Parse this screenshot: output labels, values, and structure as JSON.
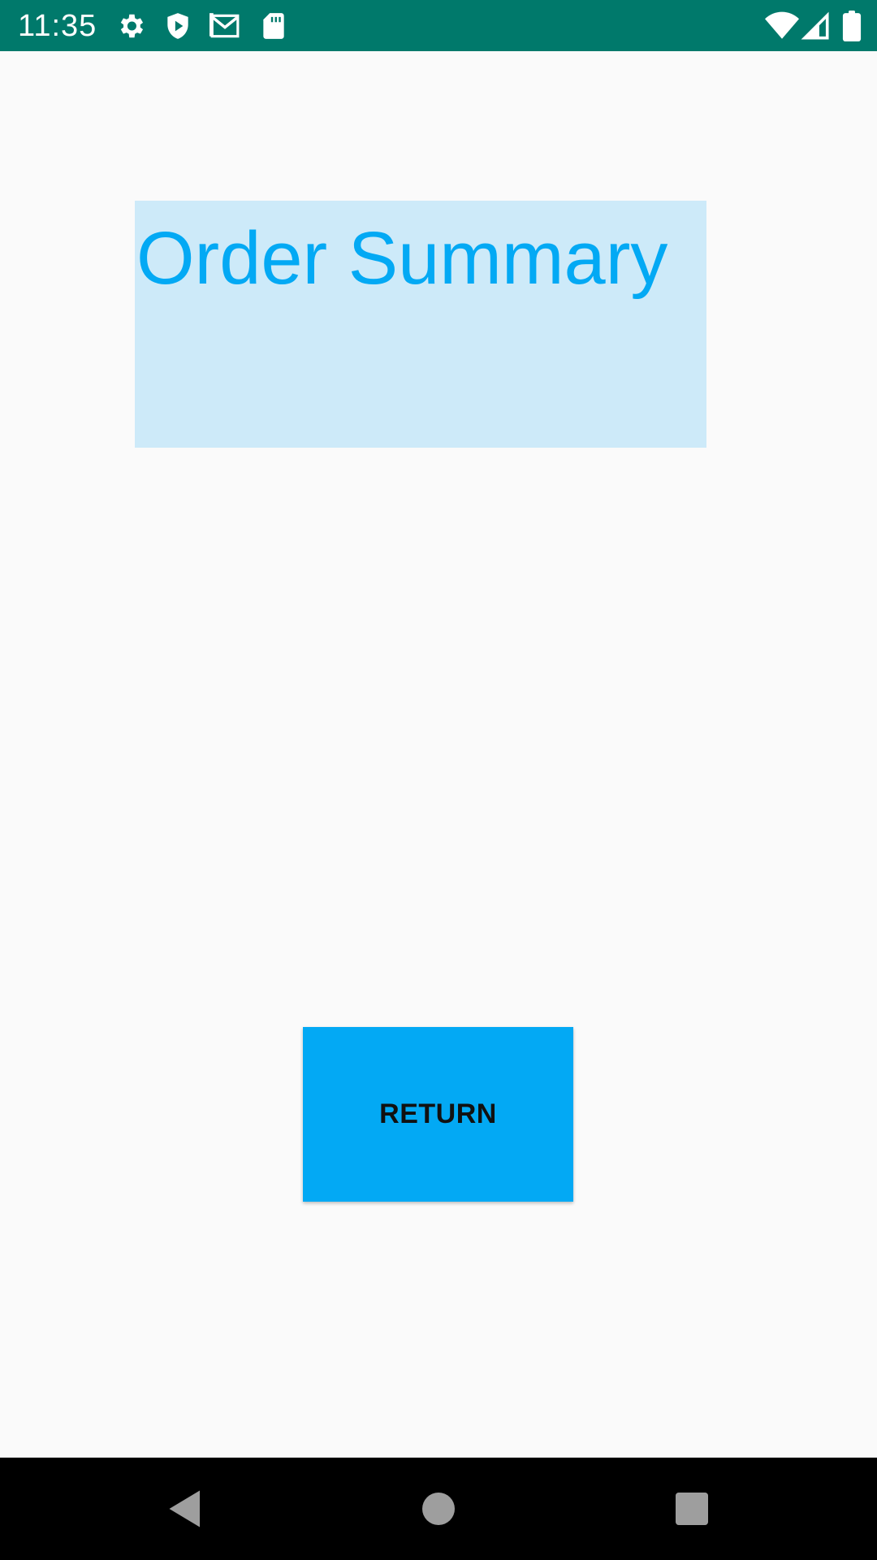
{
  "status_bar": {
    "time": "11:35",
    "background_color": "#00796b",
    "left_icons": [
      "gear-icon",
      "shield-play-icon",
      "gmail-icon",
      "sd-card-icon"
    ],
    "right_icons": [
      "wifi-icon",
      "signal-icon",
      "battery-icon"
    ]
  },
  "main": {
    "title": "Order Summary",
    "title_color": "#03a9f4",
    "title_background": "#cdeaf9",
    "return_button_label": "RETURN",
    "return_button_color": "#03a9f4"
  },
  "nav_bar": {
    "buttons": [
      "back-icon",
      "home-icon",
      "recents-icon"
    ]
  }
}
